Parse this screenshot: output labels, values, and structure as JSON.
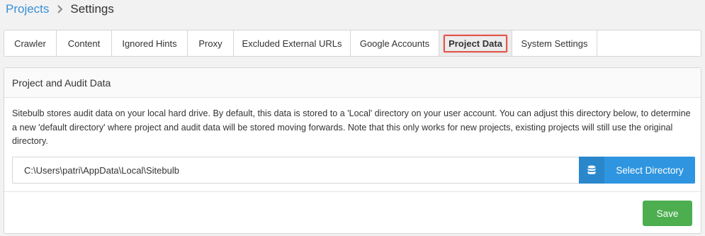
{
  "breadcrumb": {
    "parent": "Projects",
    "current": "Settings"
  },
  "tabs": [
    {
      "label": "Crawler",
      "active": false
    },
    {
      "label": "Content",
      "active": false
    },
    {
      "label": "Ignored Hints",
      "active": false
    },
    {
      "label": "Proxy",
      "active": false
    },
    {
      "label": "Excluded External URLs",
      "active": false
    },
    {
      "label": "Google Accounts",
      "active": false
    },
    {
      "label": "Project Data",
      "active": true
    },
    {
      "label": "System Settings",
      "active": false
    }
  ],
  "panel": {
    "title": "Project and Audit Data",
    "description": "Sitebulb stores audit data on your local hard drive. By default, this data is stored to a 'Local' directory on your user account. You can adjust this directory below, to determine a new 'default directory' where project and audit data will be stored moving forwards. Note that this only works for new projects, existing projects will still use the original directory.",
    "directory_value": "C:\\Users\\patri\\AppData\\Local\\Sitebulb",
    "select_directory_label": "Select Directory",
    "save_label": "Save"
  },
  "icons": {
    "breadcrumb_separator": "chevron-right-icon",
    "select_directory": "database-icon"
  },
  "colors": {
    "link": "#3a8fd6",
    "select_button": "#2f95e0",
    "save_button": "#4cae4f",
    "active_tab_highlight": "#e2574c"
  }
}
